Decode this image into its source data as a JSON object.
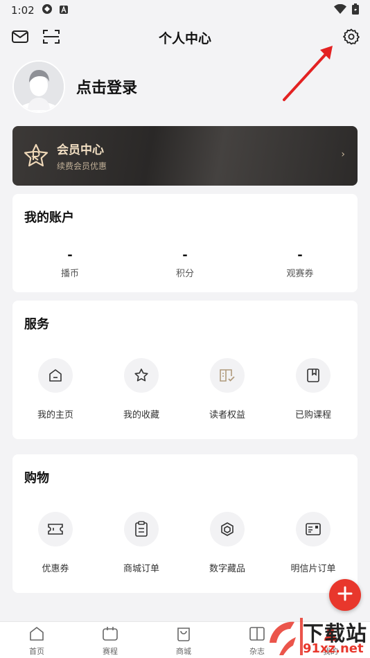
{
  "status_bar": {
    "time": "1:02"
  },
  "header": {
    "title": "个人中心"
  },
  "profile": {
    "login_text": "点击登录"
  },
  "vip": {
    "title": "会员中心",
    "subtitle": "续费会员优惠",
    "chevron": "›"
  },
  "account": {
    "title": "我的账户",
    "items": [
      {
        "value": "-",
        "label": "播币"
      },
      {
        "value": "-",
        "label": "积分"
      },
      {
        "value": "-",
        "label": "观赛券"
      }
    ]
  },
  "services": {
    "title": "服务",
    "items": [
      {
        "label": "我的主页",
        "icon": "home-icon"
      },
      {
        "label": "我的收藏",
        "icon": "star-icon"
      },
      {
        "label": "读者权益",
        "icon": "book-check-icon"
      },
      {
        "label": "已购课程",
        "icon": "bookmark-book-icon"
      }
    ]
  },
  "shopping": {
    "title": "购物",
    "items": [
      {
        "label": "优惠券",
        "icon": "ticket-icon"
      },
      {
        "label": "商城订单",
        "icon": "clipboard-icon"
      },
      {
        "label": "数字藏品",
        "icon": "cube-icon"
      },
      {
        "label": "明信片订单",
        "icon": "postcard-icon"
      }
    ]
  },
  "tabbar": {
    "items": [
      {
        "label": "首页",
        "icon": "home-icon"
      },
      {
        "label": "赛程",
        "icon": "calendar-icon"
      },
      {
        "label": "商城",
        "icon": "bag-icon"
      },
      {
        "label": "杂志",
        "icon": "magazine-icon"
      },
      {
        "label": "我的",
        "icon": "user-icon"
      }
    ]
  },
  "watermark": {
    "line1": "下载站",
    "line2": "91xz.net"
  },
  "colors": {
    "accent": "#e8372c",
    "vip_gold": "#f2dfc3",
    "background": "#f3f3f5"
  }
}
